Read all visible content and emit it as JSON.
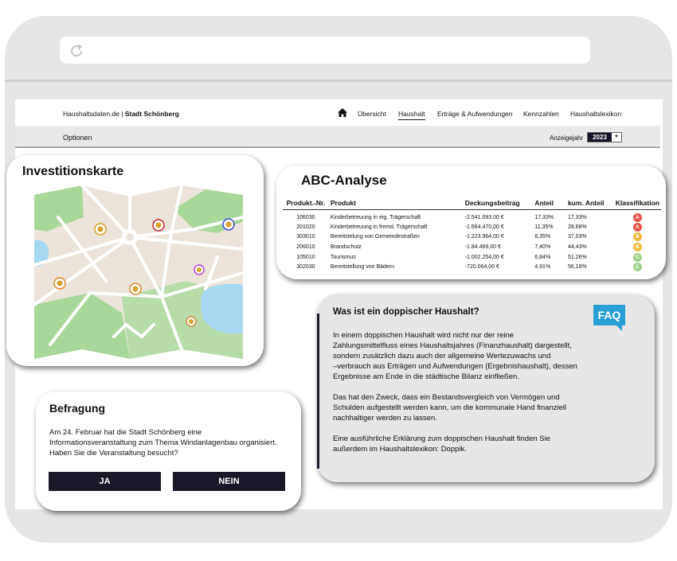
{
  "nav": {
    "brand_site": "Haushaltsdaten.de",
    "brand_sep": " | ",
    "brand_city": "Stadt Schönberg",
    "home_icon": "home-icon",
    "links": [
      "Übersicht",
      "Haushalt",
      "Erträge & Aufwendungen",
      "Kennzahlen",
      "Haushaltslexikon"
    ],
    "active": "Haushalt"
  },
  "optionbar": {
    "options_label": "Optionen",
    "year_label": "Anzeigejahr",
    "year_value": "2023"
  },
  "map": {
    "title": "Investitionskarte"
  },
  "abc": {
    "title": "ABC-Analyse",
    "columns": [
      "Produkt.-Nr.",
      "Produkt",
      "Deckungsbeitrag",
      "Anteil",
      "kum. Anteil",
      "Klassifikation"
    ],
    "rows": [
      {
        "nr": "106030",
        "produkt": "Kinderbetreuung in eig. Trägerschaft",
        "deckung": "-2.541.093,00 €",
        "anteil": "17,33%",
        "kum": "17,33%",
        "klasse": "A"
      },
      {
        "nr": "201020",
        "produkt": "Kinderbetreuung in fremd. Trägerschaft",
        "deckung": "-1.664.470,00 €",
        "anteil": "11,35%",
        "kum": "28,68%",
        "klasse": "A"
      },
      {
        "nr": "303010",
        "produkt": "Bereitstelung von Gemeindestraßen",
        "deckung": "-1.223.964,00 €",
        "anteil": "8,35%",
        "kum": "37,03%",
        "klasse": "B"
      },
      {
        "nr": "206010",
        "produkt": "Brandschutz",
        "deckung": "-1.84.469,00 €",
        "anteil": "7,40%",
        "kum": "44,43%",
        "klasse": "B"
      },
      {
        "nr": "105010",
        "produkt": "Tourismus",
        "deckung": "-1.002.254,00 €",
        "anteil": "6,84%",
        "kum": "51,26%",
        "klasse": "C"
      },
      {
        "nr": "302030",
        "produkt": "Bereitstellung von Bädern",
        "deckung": "-720.064,00 €",
        "anteil": "4,91%",
        "kum": "56,18%",
        "klasse": "C"
      }
    ],
    "class_colors": {
      "A": "#e8534a",
      "B": "#f2b93b",
      "C": "#9fd18a"
    }
  },
  "faq": {
    "title": "Was ist ein doppischer Haushalt?",
    "badge": "FAQ",
    "paragraphs": [
      "In einem doppischen Haushalt wird nicht nur der reine\nZahlungsmittelfluss eines Haushaltsjahres (Finanzhaushalt) dargestellt,\n sondern zusätzlich dazu auch der allgemeine Wertezuwachs und\n–verbrauch aus Erträgen und Aufwendungen (Ergebnishaushalt), dessen\nErgebnisse am Ende in die städtische Bilanz einfließen.",
      "Das hat den Zweck, dass ein Bestandsvergleich von Vermögen und\nSchulden aufgestellt werden kann, um die kommunale Hand finanziell\nnachhaltiger werden zu lassen.",
      "Eine ausführliche Erklärung zum doppischen Haushalt finden Sie\naußerdem im Haushaltslexikon: Doppik."
    ]
  },
  "survey": {
    "title": "Befragung",
    "question": "Am 24. Februar hat die Stadt Schönberg eine Informationsveranstaltung zum Thema Windanlagenbau organisiert. Haben Sie die Veranstaltung besucht?",
    "yes_label": "JA",
    "no_label": "NEIN"
  }
}
